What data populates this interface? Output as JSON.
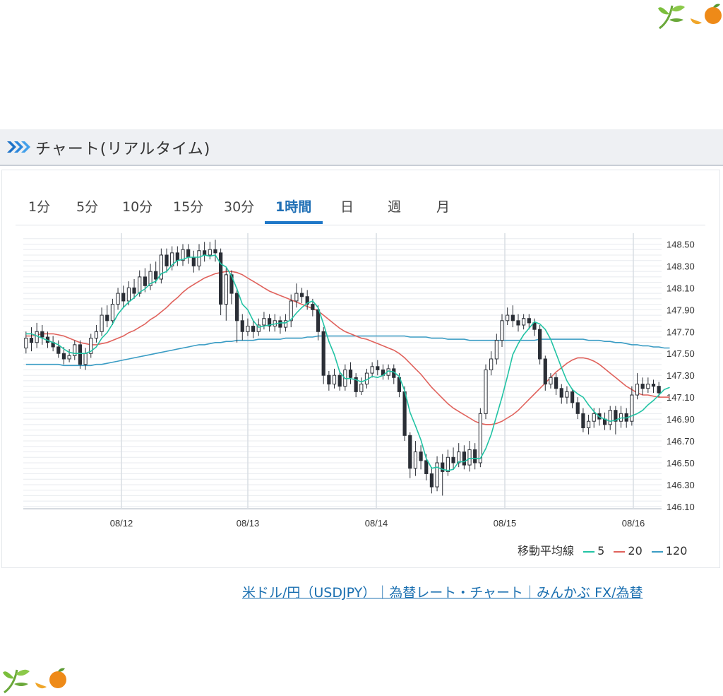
{
  "header": {
    "title": "チャート(リアルタイム)"
  },
  "tabs": [
    {
      "label": "1分",
      "active": false
    },
    {
      "label": "5分",
      "active": false
    },
    {
      "label": "10分",
      "active": false
    },
    {
      "label": "15分",
      "active": false
    },
    {
      "label": "30分",
      "active": false
    },
    {
      "label": "1時間",
      "active": true
    },
    {
      "label": "日",
      "active": false
    },
    {
      "label": "週",
      "active": false
    },
    {
      "label": "月",
      "active": false
    }
  ],
  "colors": {
    "accent": "#1f78c8",
    "ma5": "#22c3a4",
    "ma20": "#e0625c",
    "ma120": "#3a9cc4",
    "candle": "#2b2f36"
  },
  "icons": {
    "header": "chevron-double-right-icon",
    "decoration": "leaf-and-orange-icon"
  },
  "legend": {
    "title": "移動平均線",
    "items": [
      {
        "label": "5",
        "color": "#22c3a4"
      },
      {
        "label": "20",
        "color": "#e0625c"
      },
      {
        "label": "120",
        "color": "#3a9cc4"
      }
    ]
  },
  "source_link": "米ドル/円（USDJPY）｜為替レート・チャート｜みんかぶ FX/為替",
  "chart_data": {
    "type": "candlestick",
    "interval": "1時間",
    "x_labels": [
      "08/12",
      "08/13",
      "08/14",
      "08/15",
      "08/16"
    ],
    "y_ticks": [
      "146.10",
      "146.30",
      "146.50",
      "146.70",
      "146.90",
      "147.10",
      "147.30",
      "147.50",
      "147.70",
      "147.90",
      "148.10",
      "148.30",
      "148.50"
    ],
    "ylim": [
      146.08,
      148.6
    ],
    "grid": true,
    "legend_position": "bottom-right",
    "candles": [
      [
        147.55,
        147.64,
        147.7,
        147.5
      ],
      [
        147.64,
        147.6,
        147.74,
        147.52
      ],
      [
        147.6,
        147.7,
        147.78,
        147.55
      ],
      [
        147.7,
        147.65,
        147.76,
        147.58
      ],
      [
        147.65,
        147.6,
        147.7,
        147.55
      ],
      [
        147.6,
        147.56,
        147.66,
        147.52
      ],
      [
        147.56,
        147.5,
        147.62,
        147.46
      ],
      [
        147.5,
        147.45,
        147.56,
        147.4
      ],
      [
        147.45,
        147.48,
        147.54,
        147.42
      ],
      [
        147.48,
        147.58,
        147.62,
        147.44
      ],
      [
        147.58,
        147.4,
        147.62,
        147.36
      ],
      [
        147.4,
        147.5,
        147.55,
        147.35
      ],
      [
        147.5,
        147.64,
        147.68,
        147.46
      ],
      [
        147.64,
        147.7,
        147.76,
        147.6
      ],
      [
        147.7,
        147.85,
        147.92,
        147.66
      ],
      [
        147.85,
        147.8,
        147.94,
        147.74
      ],
      [
        147.8,
        147.95,
        148.0,
        147.76
      ],
      [
        147.95,
        148.05,
        148.1,
        147.9
      ],
      [
        148.05,
        147.98,
        148.12,
        147.92
      ],
      [
        147.98,
        148.1,
        148.16,
        147.94
      ],
      [
        148.1,
        148.05,
        148.18,
        148.0
      ],
      [
        148.05,
        148.2,
        148.26,
        148.02
      ],
      [
        148.2,
        148.12,
        148.28,
        148.06
      ],
      [
        148.12,
        148.25,
        148.32,
        148.08
      ],
      [
        148.25,
        148.18,
        148.34,
        148.14
      ],
      [
        148.18,
        148.4,
        148.46,
        148.14
      ],
      [
        148.4,
        148.3,
        148.46,
        148.24
      ],
      [
        148.3,
        148.42,
        148.48,
        148.26
      ],
      [
        148.42,
        148.35,
        148.48,
        148.3
      ],
      [
        148.35,
        148.45,
        148.5,
        148.3
      ],
      [
        148.45,
        148.38,
        148.5,
        148.32
      ],
      [
        148.38,
        148.3,
        148.44,
        148.24
      ],
      [
        148.3,
        148.44,
        148.5,
        148.26
      ],
      [
        148.44,
        148.4,
        148.52,
        148.34
      ],
      [
        148.4,
        148.45,
        148.52,
        148.36
      ],
      [
        148.45,
        148.42,
        148.54,
        148.34
      ],
      [
        148.42,
        147.95,
        148.46,
        147.85
      ],
      [
        147.95,
        148.22,
        148.28,
        147.8
      ],
      [
        148.22,
        148.05,
        148.26,
        147.95
      ],
      [
        148.05,
        147.8,
        148.1,
        147.6
      ],
      [
        147.8,
        147.7,
        147.86,
        147.62
      ],
      [
        147.7,
        147.75,
        147.82,
        147.66
      ],
      [
        147.75,
        147.7,
        147.8,
        147.64
      ],
      [
        147.7,
        147.76,
        147.82,
        147.66
      ],
      [
        147.76,
        147.82,
        147.88,
        147.72
      ],
      [
        147.82,
        147.75,
        147.86,
        147.7
      ],
      [
        147.75,
        147.8,
        147.86,
        147.7
      ],
      [
        147.8,
        147.74,
        147.84,
        147.68
      ],
      [
        147.74,
        147.8,
        147.86,
        147.7
      ],
      [
        147.8,
        147.98,
        148.04,
        147.74
      ],
      [
        147.98,
        148.05,
        148.14,
        147.92
      ],
      [
        148.05,
        148.02,
        148.1,
        147.96
      ],
      [
        148.02,
        147.95,
        148.08,
        147.9
      ],
      [
        147.95,
        147.9,
        148.0,
        147.84
      ],
      [
        147.9,
        147.7,
        147.94,
        147.62
      ],
      [
        147.7,
        147.3,
        147.74,
        147.22
      ],
      [
        147.3,
        147.22,
        147.34,
        147.16
      ],
      [
        147.22,
        147.3,
        147.36,
        147.18
      ],
      [
        147.3,
        147.2,
        147.34,
        147.16
      ],
      [
        147.2,
        147.35,
        147.4,
        147.16
      ],
      [
        147.35,
        147.28,
        147.42,
        147.22
      ],
      [
        147.28,
        147.15,
        147.32,
        147.1
      ],
      [
        147.15,
        147.22,
        147.28,
        147.12
      ],
      [
        147.22,
        147.32,
        147.36,
        147.18
      ],
      [
        147.32,
        147.38,
        147.42,
        147.28
      ],
      [
        147.38,
        147.35,
        147.44,
        147.3
      ],
      [
        147.35,
        147.3,
        147.4,
        147.26
      ],
      [
        147.3,
        147.36,
        147.4,
        147.26
      ],
      [
        147.36,
        147.28,
        147.4,
        147.22
      ],
      [
        147.28,
        147.15,
        147.32,
        147.1
      ],
      [
        147.15,
        146.75,
        147.2,
        146.7
      ],
      [
        146.75,
        146.45,
        146.78,
        146.36
      ],
      [
        146.45,
        146.6,
        146.7,
        146.38
      ],
      [
        146.6,
        146.52,
        146.66,
        146.44
      ],
      [
        146.52,
        146.4,
        146.58,
        146.34
      ],
      [
        146.4,
        146.28,
        146.46,
        146.22
      ],
      [
        146.28,
        146.5,
        146.56,
        146.24
      ],
      [
        146.5,
        146.42,
        146.58,
        146.2
      ],
      [
        146.42,
        146.55,
        146.62,
        146.38
      ],
      [
        146.55,
        146.5,
        146.64,
        146.44
      ],
      [
        146.5,
        146.6,
        146.68,
        146.46
      ],
      [
        146.6,
        146.48,
        146.66,
        146.44
      ],
      [
        146.48,
        146.62,
        146.7,
        146.42
      ],
      [
        146.62,
        146.5,
        146.68,
        146.44
      ],
      [
        146.5,
        146.95,
        147.0,
        146.46
      ],
      [
        146.95,
        147.35,
        147.4,
        146.9
      ],
      [
        147.35,
        147.45,
        147.52,
        147.3
      ],
      [
        147.45,
        147.62,
        147.68,
        147.4
      ],
      [
        147.62,
        147.8,
        147.86,
        147.56
      ],
      [
        147.8,
        147.85,
        147.92,
        147.76
      ],
      [
        147.85,
        147.8,
        147.94,
        147.74
      ],
      [
        147.8,
        147.76,
        147.86,
        147.7
      ],
      [
        147.76,
        147.82,
        147.86,
        147.72
      ],
      [
        147.82,
        147.78,
        147.86,
        147.72
      ],
      [
        147.78,
        147.72,
        147.82,
        147.66
      ],
      [
        147.72,
        147.45,
        147.76,
        147.4
      ],
      [
        147.45,
        147.22,
        147.48,
        147.16
      ],
      [
        147.22,
        147.28,
        147.32,
        147.18
      ],
      [
        147.28,
        147.18,
        147.32,
        147.12
      ],
      [
        147.18,
        147.1,
        147.22,
        147.04
      ],
      [
        147.1,
        147.15,
        147.2,
        147.04
      ],
      [
        147.15,
        147.05,
        147.18,
        147.0
      ],
      [
        147.05,
        146.95,
        147.1,
        146.9
      ],
      [
        146.95,
        146.82,
        147.0,
        146.78
      ],
      [
        146.82,
        146.88,
        146.94,
        146.76
      ],
      [
        146.88,
        146.95,
        147.0,
        146.82
      ],
      [
        146.95,
        146.9,
        147.0,
        146.84
      ],
      [
        146.9,
        146.85,
        146.96,
        146.8
      ],
      [
        146.85,
        146.98,
        147.02,
        146.8
      ],
      [
        146.98,
        146.88,
        147.02,
        146.76
      ],
      [
        146.88,
        146.95,
        147.02,
        146.82
      ],
      [
        146.95,
        146.88,
        147.0,
        146.82
      ],
      [
        146.88,
        147.12,
        147.2,
        146.84
      ],
      [
        147.12,
        147.22,
        147.32,
        147.08
      ],
      [
        147.22,
        147.18,
        147.28,
        147.12
      ],
      [
        147.18,
        147.22,
        147.28,
        147.14
      ],
      [
        147.22,
        147.2,
        147.26,
        147.14
      ],
      [
        147.2,
        147.14,
        147.24,
        147.1
      ]
    ],
    "ma5": [
      147.68,
      147.68,
      147.66,
      147.64,
      147.62,
      147.6,
      147.58,
      147.54,
      147.51,
      147.5,
      147.5,
      147.5,
      147.52,
      147.56,
      147.64,
      147.69,
      147.77,
      147.86,
      147.92,
      147.97,
      148.01,
      148.06,
      148.09,
      148.14,
      148.16,
      148.23,
      148.25,
      148.31,
      148.35,
      148.36,
      148.38,
      148.38,
      148.38,
      148.4,
      148.39,
      148.4,
      148.32,
      148.29,
      148.21,
      148.09,
      147.95,
      147.9,
      147.8,
      147.74,
      147.75,
      147.76,
      147.77,
      147.78,
      147.78,
      147.81,
      147.87,
      147.92,
      147.96,
      147.98,
      147.92,
      147.77,
      147.61,
      147.49,
      147.33,
      147.27,
      147.27,
      147.26,
      147.24,
      147.26,
      147.29,
      147.28,
      147.3,
      147.34,
      147.33,
      147.29,
      147.16,
      146.96,
      146.84,
      146.71,
      146.54,
      146.45,
      146.46,
      146.44,
      146.43,
      146.44,
      146.51,
      146.51,
      146.54,
      146.54,
      146.54,
      146.63,
      146.76,
      146.93,
      147.1,
      147.29,
      147.49,
      147.59,
      147.67,
      147.73,
      147.79,
      147.77,
      147.72,
      147.63,
      147.5,
      147.37,
      147.25,
      147.17,
      147.13,
      147.1,
      147.03,
      146.97,
      146.92,
      146.9,
      146.88,
      146.89,
      146.91,
      146.91,
      146.93,
      146.95,
      146.98,
      147.03,
      147.07,
      147.12,
      147.17,
      147.19
    ],
    "ma20": [
      147.66,
      147.66,
      147.67,
      147.68,
      147.68,
      147.68,
      147.67,
      147.66,
      147.64,
      147.62,
      147.6,
      147.59,
      147.58,
      147.58,
      147.59,
      147.6,
      147.62,
      147.64,
      147.66,
      147.69,
      147.71,
      147.74,
      147.77,
      147.81,
      147.84,
      147.88,
      147.92,
      147.97,
      148.01,
      148.06,
      148.1,
      148.13,
      148.16,
      148.19,
      148.21,
      148.23,
      148.24,
      148.25,
      148.25,
      148.24,
      148.22,
      148.19,
      148.16,
      148.13,
      148.1,
      148.07,
      148.05,
      148.03,
      148.01,
      147.99,
      147.97,
      147.95,
      147.93,
      147.91,
      147.89,
      147.85,
      147.81,
      147.77,
      147.73,
      147.7,
      147.68,
      147.66,
      147.64,
      147.63,
      147.61,
      147.59,
      147.57,
      147.55,
      147.53,
      147.5,
      147.46,
      147.41,
      147.36,
      147.31,
      147.25,
      147.19,
      147.14,
      147.09,
      147.04,
      147.0,
      146.97,
      146.94,
      146.91,
      146.88,
      146.86,
      146.85,
      146.85,
      146.86,
      146.88,
      146.91,
      146.94,
      146.98,
      147.03,
      147.08,
      147.13,
      147.18,
      147.23,
      147.28,
      147.33,
      147.37,
      147.41,
      147.44,
      147.46,
      147.46,
      147.45,
      147.43,
      147.4,
      147.36,
      147.32,
      147.28,
      147.24,
      147.2,
      147.17,
      147.14,
      147.12,
      147.12,
      147.11,
      147.1,
      147.1,
      147.1
    ],
    "ma120": [
      147.4,
      147.4,
      147.4,
      147.4,
      147.4,
      147.4,
      147.4,
      147.39,
      147.39,
      147.39,
      147.39,
      147.39,
      147.39,
      147.4,
      147.4,
      147.41,
      147.42,
      147.43,
      147.44,
      147.45,
      147.46,
      147.47,
      147.48,
      147.49,
      147.5,
      147.51,
      147.52,
      147.53,
      147.54,
      147.55,
      147.56,
      147.57,
      147.58,
      147.58,
      147.59,
      147.6,
      147.6,
      147.61,
      147.61,
      147.62,
      147.62,
      147.62,
      147.62,
      147.63,
      147.63,
      147.63,
      147.63,
      147.63,
      147.64,
      147.64,
      147.64,
      147.64,
      147.65,
      147.65,
      147.66,
      147.66,
      147.66,
      147.66,
      147.66,
      147.66,
      147.66,
      147.66,
      147.66,
      147.66,
      147.66,
      147.66,
      147.66,
      147.66,
      147.66,
      147.66,
      147.66,
      147.65,
      147.65,
      147.65,
      147.65,
      147.64,
      147.64,
      147.64,
      147.63,
      147.63,
      147.63,
      147.63,
      147.62,
      147.62,
      147.62,
      147.62,
      147.62,
      147.62,
      147.62,
      147.62,
      147.62,
      147.62,
      147.62,
      147.62,
      147.62,
      147.63,
      147.63,
      147.63,
      147.63,
      147.63,
      147.63,
      147.63,
      147.63,
      147.63,
      147.62,
      147.62,
      147.62,
      147.61,
      147.61,
      147.6,
      147.6,
      147.59,
      147.58,
      147.58,
      147.57,
      147.57,
      147.56,
      147.56,
      147.55,
      147.55
    ]
  }
}
